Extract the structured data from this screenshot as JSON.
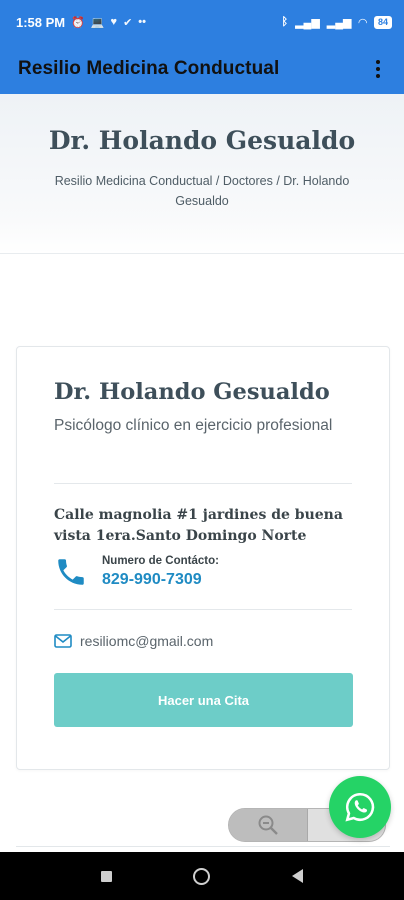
{
  "status_bar": {
    "time": "1:58 PM",
    "battery": "84"
  },
  "app_bar": {
    "title": "Resilio Medicina Conductual"
  },
  "hero": {
    "title": "Dr. Holando Gesualdo",
    "breadcrumb": "Resilio Medicina Conductual / Doctores / Dr. Holando Gesualdo"
  },
  "card": {
    "name": "Dr. Holando Gesualdo",
    "role": "Psicólogo clínico en ejercicio profesional",
    "address": "Calle magnolia #1 jardines de buena vista 1era.Santo Domingo Norte",
    "contact_label": "Numero de Contácto:",
    "phone": "829-990-7309",
    "email": "resiliomc@gmail.com",
    "cta_label": "Hacer una Cita"
  },
  "colors": {
    "app_bar": "#2d7fe0",
    "cta": "#6dcdc8",
    "phone_accent": "#1f8bc3",
    "whatsapp": "#25d366"
  }
}
